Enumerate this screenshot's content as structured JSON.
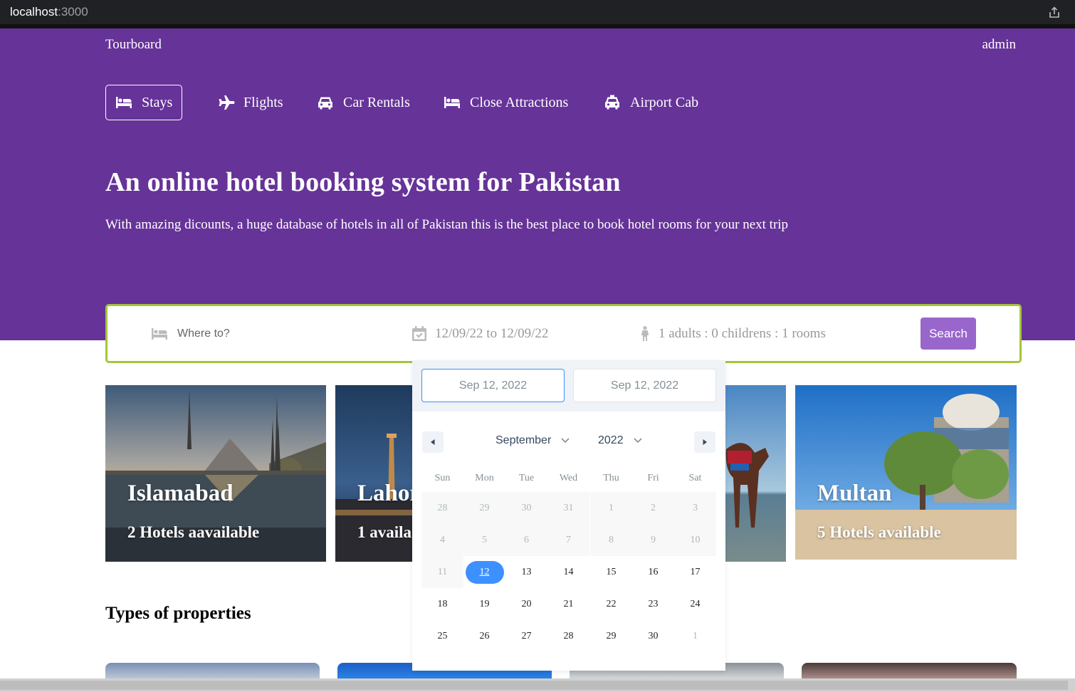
{
  "browser": {
    "url_host": "localhost",
    "url_port": ":3000"
  },
  "header": {
    "brand": "Tourboard",
    "user": "admin",
    "nav": [
      {
        "label": "Stays",
        "icon": "bed-icon"
      },
      {
        "label": "Flights",
        "icon": "plane-icon"
      },
      {
        "label": "Car Rentals",
        "icon": "car-icon"
      },
      {
        "label": "Close Attractions",
        "icon": "bed-icon"
      },
      {
        "label": "Airport Cab",
        "icon": "taxi-icon"
      }
    ],
    "title": "An online hotel booking system for Pakistan",
    "subtitle": "With amazing dicounts, a huge database of hotels in all of Pakistan this is the best place to book hotel rooms for your next trip"
  },
  "search": {
    "destination_placeholder": "Where to?",
    "dates": "12/09/22 to 12/09/22",
    "options": "1 adults : 0 childrens : 1 rooms",
    "button": "Search"
  },
  "date_picker": {
    "start_input": "Sep 12, 2022",
    "end_input": "Sep 12, 2022",
    "month": "September",
    "year": "2022",
    "weekdays": [
      "Sun",
      "Mon",
      "Tue",
      "Wed",
      "Thu",
      "Fri",
      "Sat"
    ],
    "weeks": [
      [
        "28",
        "29",
        "30",
        "31",
        "1",
        "2",
        "3"
      ],
      [
        "4",
        "5",
        "6",
        "7",
        "8",
        "9",
        "10"
      ],
      [
        "11",
        "12",
        "13",
        "14",
        "15",
        "16",
        "17"
      ],
      [
        "18",
        "19",
        "20",
        "21",
        "22",
        "23",
        "24"
      ],
      [
        "25",
        "26",
        "27",
        "28",
        "29",
        "30",
        "1"
      ]
    ],
    "selected_day": "12"
  },
  "cities": [
    {
      "name": "Islamabad",
      "count": "2 Hotels aavailable"
    },
    {
      "name": "Lahor",
      "count": "1 availa"
    },
    {
      "name": "",
      "count": ""
    },
    {
      "name": "Multan",
      "count": "5 Hotels available"
    }
  ],
  "types_title": "Types of properties",
  "colors": {
    "hero": "#663399",
    "search_border": "#a4c639",
    "search_button": "#9966cc",
    "selected_day": "#3d91ff"
  }
}
